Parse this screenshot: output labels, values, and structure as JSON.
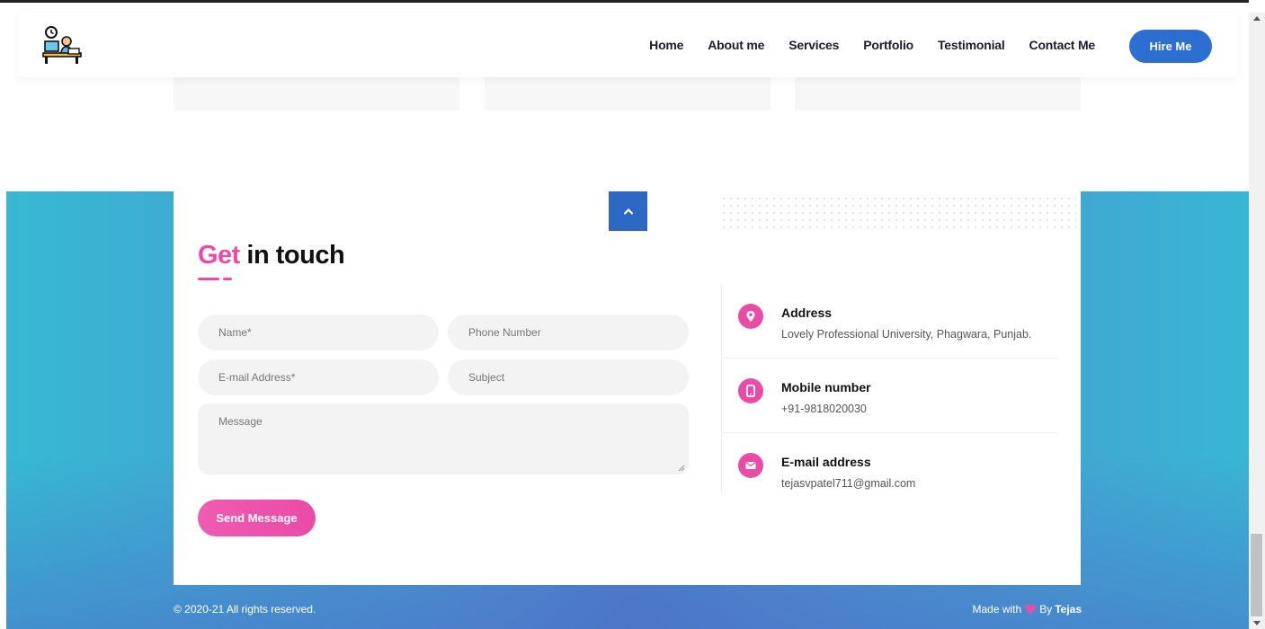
{
  "header": {
    "nav": [
      "Home",
      "About me",
      "Services",
      "Portfolio",
      "Testimonial",
      "Contact Me"
    ],
    "hire_label": "Hire Me",
    "logo_icon": "person-at-desk-clock-icon"
  },
  "contact": {
    "title_accent": "Get",
    "title_rest": " in touch",
    "form": {
      "name_placeholder": "Name*",
      "phone_placeholder": "Phone Number",
      "email_placeholder": "E-mail Address*",
      "subject_placeholder": "Subject",
      "message_placeholder": "Message",
      "send_label": "Send Message"
    },
    "info": [
      {
        "label": "Address",
        "value": "Lovely Professional University, Phagwara, Punjab.",
        "icon": "location-pin-icon"
      },
      {
        "label": "Mobile number",
        "value": "+91-9818020030",
        "icon": "mobile-phone-icon"
      },
      {
        "label": "E-mail address",
        "value": "tejasvpatel711@gmail.com",
        "icon": "envelope-icon"
      }
    ]
  },
  "footer": {
    "copyright": "© 2020-21 All rights reserved.",
    "made_with": "Made with",
    "by": "By",
    "author": "Tejas"
  },
  "colors": {
    "accent_pink": "#e94ba7",
    "primary_blue": "#2c6fd1",
    "gradient_cyan": "#36b9d3"
  }
}
